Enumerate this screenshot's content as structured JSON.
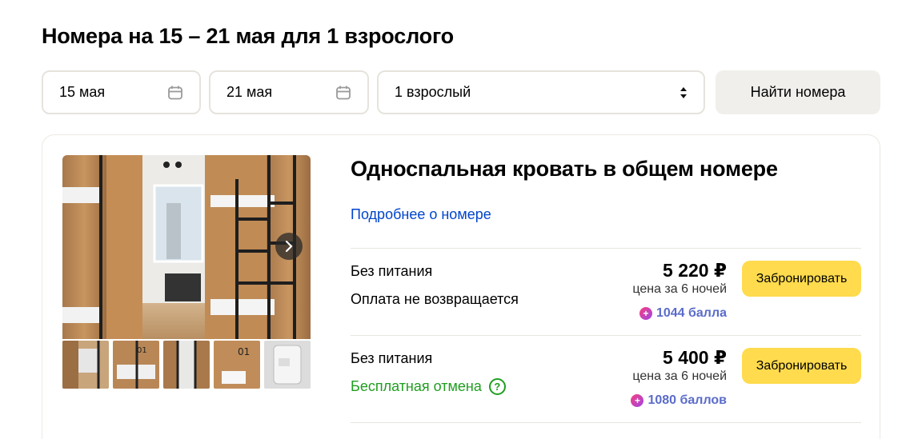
{
  "page": {
    "title": "Номера на 15 – 21 мая для 1 взрослого"
  },
  "search": {
    "date_from": "15 мая",
    "date_to": "21 мая",
    "guests": "1 взрослый",
    "find_label": "Найти номера"
  },
  "room": {
    "title": "Односпальная кровать в общем номере",
    "details_link": "Подробнее о номере",
    "photo_count_thumbs": 5,
    "rates": [
      {
        "meal": "Без питания",
        "policy": "Оплата не возвращается",
        "price": "5 220 ₽",
        "nights": "цена за 6 ночей",
        "points": "1044 балла",
        "book_label": "Забронировать"
      },
      {
        "meal": "Без питания",
        "policy": "Бесплатная отмена",
        "price": "5 400 ₽",
        "nights": "цена за 6 ночей",
        "points": "1080 баллов",
        "book_label": "Забронировать"
      }
    ]
  },
  "icons": {
    "calendar": "calendar-icon",
    "sort": "sort-arrows-icon",
    "next": "chevron-right-icon",
    "help": "question-icon",
    "plus": "plus-points-icon"
  },
  "colors": {
    "accent_yellow": "#ffdb4d",
    "link_blue": "#0044cc",
    "free_cancel_green": "#1f9e1f",
    "points_blue": "#5b6cc9"
  }
}
